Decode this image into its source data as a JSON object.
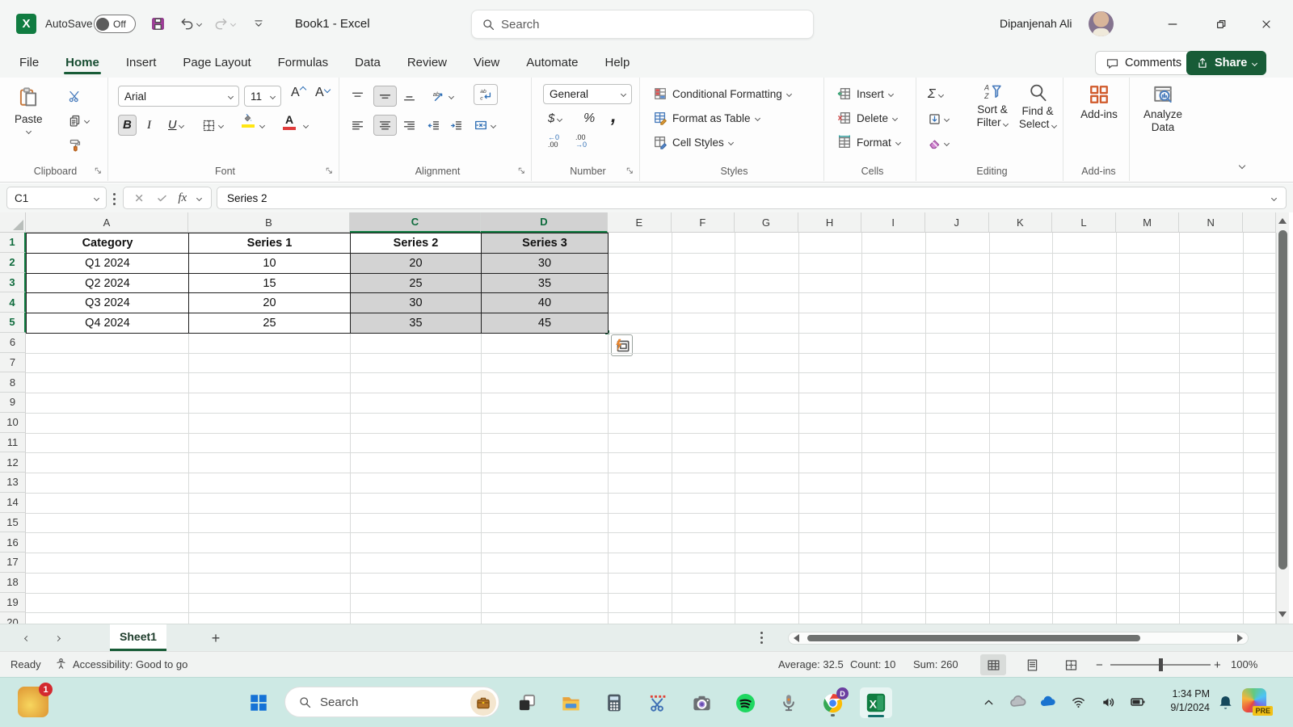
{
  "window": {
    "title": "Book1  -  Excel",
    "user": "Dipanjenah Ali"
  },
  "titlebar": {
    "autosave_label": "AutoSave",
    "autosave_state": "Off",
    "search_placeholder": "Search"
  },
  "menubar": {
    "tabs": [
      "File",
      "Home",
      "Insert",
      "Page Layout",
      "Formulas",
      "Data",
      "Review",
      "View",
      "Automate",
      "Help"
    ],
    "active_tab": "Home",
    "comments": "Comments",
    "share": "Share"
  },
  "ribbon": {
    "clipboard": {
      "label": "Clipboard",
      "paste": "Paste"
    },
    "font": {
      "label": "Font",
      "name": "Arial",
      "size": "11"
    },
    "alignment": {
      "label": "Alignment"
    },
    "number": {
      "label": "Number",
      "format": "General"
    },
    "styles": {
      "label": "Styles",
      "conditional": "Conditional Formatting",
      "format_table": "Format as Table",
      "cell_styles": "Cell Styles"
    },
    "cells": {
      "label": "Cells",
      "insert": "Insert",
      "delete": "Delete",
      "format": "Format"
    },
    "editing": {
      "label": "Editing",
      "sort1": "Sort &",
      "sort2": "Filter",
      "find1": "Find &",
      "find2": "Select"
    },
    "addins": {
      "label": "Add-ins",
      "button": "Add-ins"
    },
    "analyze": {
      "line1": "Analyze",
      "line2": "Data"
    }
  },
  "formula_bar": {
    "name_box": "C1",
    "formula": "Series 2"
  },
  "grid": {
    "columns": [
      "A",
      "B",
      "C",
      "D",
      "E",
      "F",
      "G",
      "H",
      "I",
      "J",
      "K",
      "L",
      "M",
      "N",
      ""
    ],
    "col_widths": {
      "A": 201,
      "B": 200,
      "C": 162,
      "D": 157,
      "": 41,
      "default": 78.6
    },
    "row_count": 20,
    "selected_columns": [
      "C",
      "D"
    ],
    "selected_rows": [
      1,
      2,
      3,
      4,
      5
    ],
    "active_cell": "C1",
    "selection_range": "C1:D5",
    "table": {
      "headers": [
        "Category",
        "Series 1",
        "Series 2",
        "Series 3"
      ],
      "rows": [
        [
          "Q1 2024",
          "10",
          "20",
          "30"
        ],
        [
          "Q2 2024",
          "15",
          "25",
          "35"
        ],
        [
          "Q3 2024",
          "20",
          "30",
          "40"
        ],
        [
          "Q4 2024",
          "25",
          "35",
          "45"
        ]
      ]
    }
  },
  "sheet_tabs": {
    "active": "Sheet1"
  },
  "status_bar": {
    "ready": "Ready",
    "accessibility": "Accessibility: Good to go",
    "average": "Average: 32.5",
    "count": "Count: 10",
    "sum": "Sum: 260",
    "zoom": "100%"
  },
  "taskbar": {
    "notification_badge": "1",
    "search_placeholder": "Search",
    "app_icons": [
      "task-view",
      "file-explorer",
      "calculator",
      "snipping-tool",
      "camera",
      "spotify",
      "voice-recorder",
      "chrome",
      "excel"
    ],
    "chrome_badge": "D",
    "tray_icons": [
      "tray-chevron-up",
      "cloud",
      "onedrive",
      "wifi",
      "volume",
      "battery"
    ],
    "time": "1:34 PM",
    "date": "9/1/2024",
    "copilot_badge": "PRE"
  },
  "colors": {
    "excel_green": "#107C41",
    "active_tab_underline": "#185C37",
    "selection_border": "#0E6B3C",
    "selection_fill": "#D3D3D3",
    "taskbar_bg": "#CDE9E4"
  }
}
